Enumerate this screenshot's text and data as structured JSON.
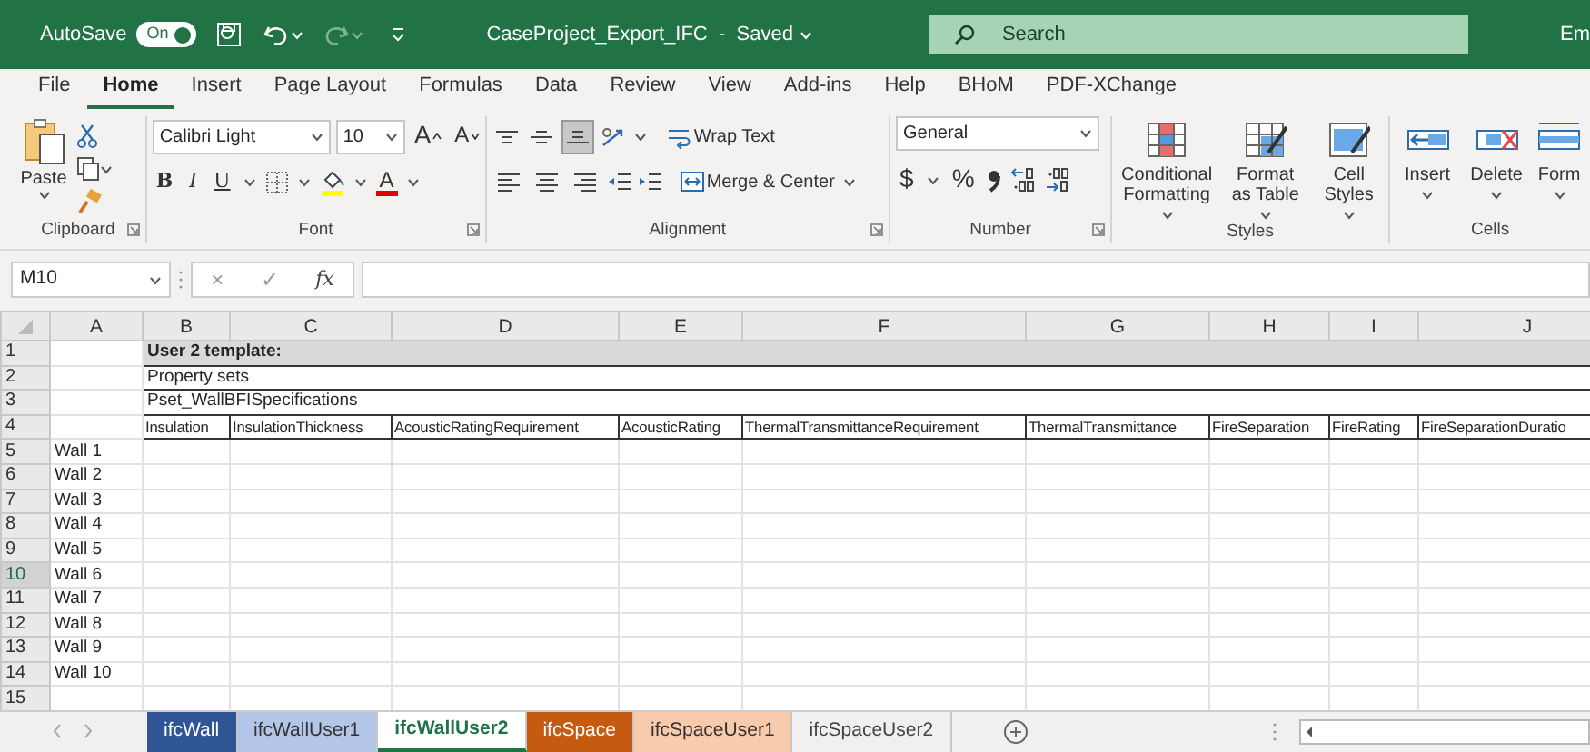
{
  "title_bar": {
    "autosave_label": "AutoSave",
    "autosave": {
      "label": "On",
      "on": true
    },
    "document_title": "CaseProject_Export_IFC  -  Saved",
    "search": {
      "placeholder": "Search"
    },
    "user": "Em"
  },
  "ribbon_tabs": [
    {
      "label": "File",
      "selected": false
    },
    {
      "label": "Home",
      "selected": true
    },
    {
      "label": "Insert",
      "selected": false
    },
    {
      "label": "Page Layout",
      "selected": false
    },
    {
      "label": "Formulas",
      "selected": false
    },
    {
      "label": "Data",
      "selected": false
    },
    {
      "label": "Review",
      "selected": false
    },
    {
      "label": "View",
      "selected": false
    },
    {
      "label": "Add-ins",
      "selected": false
    },
    {
      "label": "Help",
      "selected": false
    },
    {
      "label": "BHoM",
      "selected": false
    },
    {
      "label": "PDF-XChange",
      "selected": false
    }
  ],
  "ribbon": {
    "clipboard": {
      "paste": "Paste",
      "label": "Clipboard"
    },
    "font": {
      "font_name": "Calibri Light",
      "font_size": "10",
      "grow": "A",
      "shrink": "A",
      "bold": "B",
      "italic": "I",
      "underline": "U",
      "font_color": "A",
      "label": "Font"
    },
    "alignment": {
      "vertical": [
        {
          "selected": false
        },
        {
          "selected": false
        },
        {
          "selected": true
        }
      ],
      "wrap_text": "Wrap Text",
      "merge_center": "Merge & Center",
      "label": "Alignment"
    },
    "number": {
      "format": "General",
      "currency": "$",
      "percent": "%",
      "label": "Number"
    },
    "styles": {
      "buttons": [
        {
          "label": "Conditional Formatting",
          "kind": "conditional"
        },
        {
          "label": "Format as Table",
          "kind": "table"
        },
        {
          "label": "Cell Styles",
          "kind": "cellstyles"
        }
      ],
      "label": "Styles"
    },
    "cells": {
      "buttons": [
        {
          "label": "Insert",
          "kind": "insert"
        },
        {
          "label": "Delete",
          "kind": "delete"
        },
        {
          "label": "Form",
          "kind": "format"
        }
      ],
      "label": "Cells"
    }
  },
  "formula_bar": {
    "name_box": "M10",
    "cancel": "×",
    "enter": "✓",
    "function": "fx"
  },
  "sheet": {
    "columns": [
      "A",
      "B",
      "C",
      "D",
      "E",
      "F",
      "G",
      "H",
      "I",
      "J"
    ],
    "rows": [
      {
        "number": "1",
        "selected": false,
        "title": "User 2 template:"
      },
      {
        "number": "2",
        "selected": false,
        "span_text": "Property sets"
      },
      {
        "number": "3",
        "selected": false,
        "span_text": "Pset_WallBFISpecifications"
      },
      {
        "number": "4",
        "selected": false,
        "headers": [
          "Insulation",
          "InsulationThickness",
          "AcousticRatingRequirement",
          "AcousticRating",
          "ThermalTransmittanceRequirement",
          "ThermalTransmittance",
          "FireSeparation",
          "FireRating",
          "FireSeparationDuratio"
        ]
      },
      {
        "number": "5",
        "selected": false,
        "label": "Wall 1"
      },
      {
        "number": "6",
        "selected": false,
        "label": "Wall 2"
      },
      {
        "number": "7",
        "selected": false,
        "label": "Wall 3"
      },
      {
        "number": "8",
        "selected": false,
        "label": "Wall 4"
      },
      {
        "number": "9",
        "selected": false,
        "label": "Wall 5"
      },
      {
        "number": "10",
        "selected": true,
        "label": "Wall 6"
      },
      {
        "number": "11",
        "selected": false,
        "label": "Wall 7"
      },
      {
        "number": "12",
        "selected": false,
        "label": "Wall 8"
      },
      {
        "number": "13",
        "selected": false,
        "label": "Wall 9"
      },
      {
        "number": "14",
        "selected": false,
        "label": "Wall 10"
      },
      {
        "number": "15",
        "selected": false
      }
    ]
  },
  "sheet_tabs": [
    {
      "label": "ifcWall",
      "color": "#2f5597",
      "selected": false
    },
    {
      "label": "ifcWallUser1",
      "color": "#b4c6e7",
      "selected": false
    },
    {
      "label": "ifcWallUser2",
      "color": "#217346",
      "selected": true
    },
    {
      "label": "ifcSpace",
      "color": "#c55a11",
      "selected": false
    },
    {
      "label": "ifcSpaceUser1",
      "color": "#f8cbad",
      "selected": false
    },
    {
      "label": "ifcSpaceUser2",
      "selected": false
    }
  ]
}
